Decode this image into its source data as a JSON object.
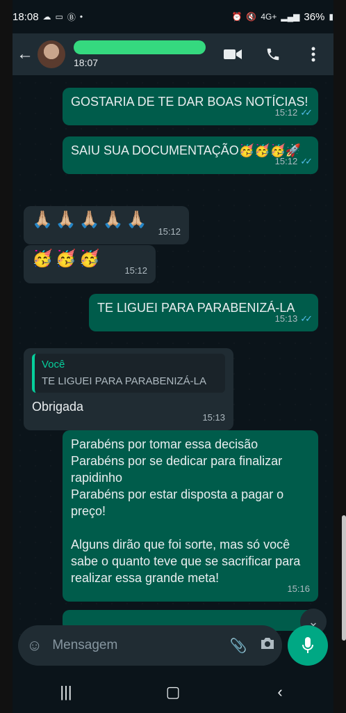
{
  "status_bar": {
    "time": "18:08",
    "battery": "36%",
    "network": "4G+"
  },
  "header": {
    "back_icon": "arrow-left-icon",
    "contact_status": "18:07",
    "video_icon": "video-camera-icon",
    "call_icon": "phone-icon",
    "menu_icon": "more-vert-icon"
  },
  "messages": [
    {
      "dir": "out",
      "text": "GOSTARIA DE TE DAR BOAS NOTÍCIAS!",
      "time": "15:12",
      "read": true
    },
    {
      "dir": "out",
      "text": "SAIU SUA DOCUMENTAÇÃO🥳🥳🥳🚀",
      "time": "15:12",
      "read": true
    },
    {
      "dir": "in",
      "text": "🙏🏼🙏🏼🙏🏼🙏🏼🙏🏼",
      "time": "15:12"
    },
    {
      "dir": "in",
      "text": "🥳🥳🥳",
      "time": "15:12"
    },
    {
      "dir": "out",
      "text": "TE LIGUEI PARA PARABENIZÁ-LA",
      "time": "15:13",
      "read": true
    },
    {
      "dir": "in",
      "quote_author": "Você",
      "quote_text": "TE LIGUEI PARA PARABENIZÁ-LA",
      "text": "Obrigada",
      "time": "15:13"
    },
    {
      "dir": "out",
      "text_lines": [
        "Parabéns por tomar essa decisão",
        "Parabéns por se dedicar para finalizar rapidinho",
        "Parabéns por estar disposta a pagar o preço!",
        "",
        "Alguns dirão que foi sorte, mas só você sabe o quanto teve que se sacrificar para realizar essa grande meta!"
      ],
      "time": "15:16"
    }
  ],
  "composer": {
    "placeholder": "Mensagem",
    "emoji_icon": "emoji-icon",
    "attach_icon": "paperclip-icon",
    "camera_icon": "camera-icon",
    "mic_icon": "microphone-icon"
  },
  "nav": {
    "recent_icon": "recents-icon",
    "home_icon": "home-icon",
    "back_icon": "back-icon"
  },
  "colors": {
    "outgoing": "#005c4b",
    "incoming": "#202c33",
    "accent": "#00a884",
    "read_ticks": "#53bdeb"
  }
}
